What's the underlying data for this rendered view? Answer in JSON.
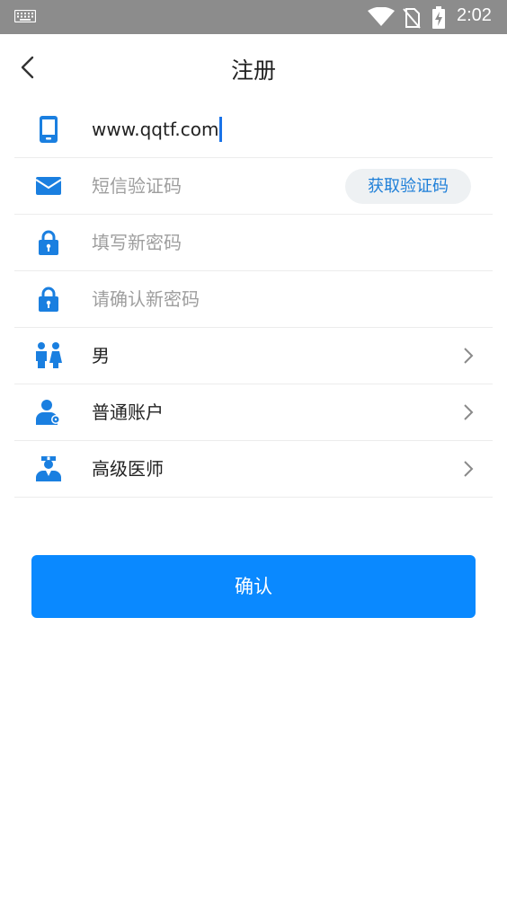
{
  "status_bar": {
    "time": "2:02"
  },
  "header": {
    "title": "注册"
  },
  "form": {
    "phone_value": "www.qqtf.com",
    "sms_code_placeholder": "短信验证码",
    "get_code_label": "获取验证码",
    "new_password_placeholder": "填写新密码",
    "confirm_password_placeholder": "请确认新密码",
    "gender_value": "男",
    "account_type_value": "普通账户",
    "title_value": "高级医师"
  },
  "confirm_label": "确认",
  "colors": {
    "accent": "#0a89ff",
    "icon": "#1a7fe0",
    "code_text": "#1e7fd8"
  }
}
